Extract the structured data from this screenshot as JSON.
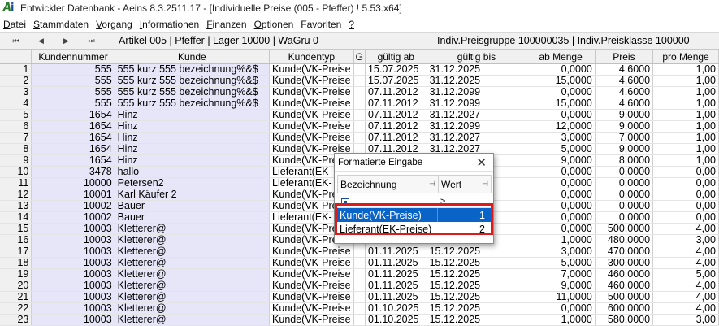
{
  "window": {
    "title": "Entwickler Datenbank - Aeins 8.3.2511.17 - [Individuelle Preise (005 - Pfeffer) ! 5.53.x64]",
    "logo_text_a": "A",
    "logo_text_i": "i"
  },
  "menu": [
    {
      "accel": "D",
      "rest": "atei"
    },
    {
      "accel": "S",
      "rest": "tammdaten"
    },
    {
      "accel": "V",
      "rest": "organg"
    },
    {
      "accel": "I",
      "rest": "nformationen"
    },
    {
      "accel": "F",
      "rest": "inanzen"
    },
    {
      "accel": "O",
      "rest": "ptionen"
    },
    {
      "accel": "",
      "rest": "Favoriten"
    },
    {
      "accel": "?",
      "rest": ""
    }
  ],
  "nav": {
    "first_icon": "first-record-icon",
    "prev_icon": "prev-record-icon",
    "next_icon": "next-record-icon",
    "last_icon": "last-record-icon",
    "info": "Artikel 005 | Pfeffer | Lager 10000 | WaGru 0",
    "right_info": "Indiv.Preisgruppe 100000035 |  Indiv.Preisklasse 100000"
  },
  "grid": {
    "columns": [
      "",
      "Kundennummer",
      "Kunde",
      "Kundentyp",
      "G",
      "gültig ab",
      "gültig bis",
      "ab Menge",
      "Preis",
      "pro Menge"
    ],
    "rows": [
      [
        "1",
        "555",
        "555 kurz 555 bezeichnung%&$",
        "Kunde(VK-Preise",
        "",
        "15.07.2025",
        "31.12.2025",
        "0,0000",
        "4,6000",
        "1,00"
      ],
      [
        "2",
        "555",
        "555 kurz 555 bezeichnung%&$",
        "Kunde(VK-Preise",
        "",
        "15.07.2025",
        "31.12.2025",
        "15,0000",
        "4,6000",
        "1,00"
      ],
      [
        "3",
        "555",
        "555 kurz 555 bezeichnung%&$",
        "Kunde(VK-Preise",
        "",
        "07.11.2012",
        "31.12.2099",
        "0,0000",
        "4,6000",
        "1,00"
      ],
      [
        "4",
        "555",
        "555 kurz 555 bezeichnung%&$",
        "Kunde(VK-Preise",
        "",
        "07.11.2012",
        "31.12.2099",
        "15,0000",
        "4,6000",
        "1,00"
      ],
      [
        "5",
        "1654",
        "Hinz",
        "Kunde(VK-Preise",
        "",
        "07.11.2012",
        "31.12.2027",
        "0,0000",
        "9,0000",
        "1,00"
      ],
      [
        "6",
        "1654",
        "Hinz",
        "Kunde(VK-Preise",
        "",
        "07.11.2012",
        "31.12.2099",
        "12,0000",
        "9,0000",
        "1,00"
      ],
      [
        "7",
        "1654",
        "Hinz",
        "Kunde(VK-Preise",
        "",
        "07.11.2012",
        "31.12.2027",
        "3,0000",
        "7,0000",
        "1,00"
      ],
      [
        "8",
        "1654",
        "Hinz",
        "Kunde(VK-Preise",
        "",
        "07.11.2012",
        "31.12.2027",
        "5,0000",
        "9,0000",
        "1,00"
      ],
      [
        "9",
        "1654",
        "Hinz",
        "Kunde(VK-Prei",
        "",
        "",
        "",
        "9,0000",
        "8,0000",
        "1,00"
      ],
      [
        "10",
        "3478",
        "hallo",
        "Lieferant(EK-",
        "",
        "",
        "",
        "0,0000",
        "0,0000",
        "0,00"
      ],
      [
        "11",
        "10000",
        "Petersen2",
        "Lieferant(EK-",
        "",
        "",
        "",
        "0,0000",
        "0,0000",
        "0,00"
      ],
      [
        "12",
        "10001",
        "Karl Käufer 2",
        "Kunde(VK-Prei",
        "",
        "",
        "",
        "0,0000",
        "0,0000",
        "0,00"
      ],
      [
        "13",
        "10002",
        "Bauer",
        "Kunde(VK-Prei",
        "",
        "",
        "",
        "0,0000",
        "0,0000",
        "0,00"
      ],
      [
        "14",
        "10002",
        "Bauer",
        "Lieferant(EK-",
        "",
        "",
        "",
        "0,0000",
        "0,0000",
        "0,00"
      ],
      [
        "15",
        "10003",
        "Kletterer@",
        "Kunde(VK-Prei",
        "",
        "",
        "",
        "0,0000",
        "500,0000",
        "4,00"
      ],
      [
        "16",
        "10003",
        "Kletterer@",
        "Kunde(VK-Prei",
        "",
        "",
        "",
        "1,0000",
        "480,0000",
        "3,00"
      ],
      [
        "17",
        "10003",
        "Kletterer@",
        "Kunde(VK-Preise",
        "",
        "01.11.2025",
        "15.12.2025",
        "3,0000",
        "470,0000",
        "4,00"
      ],
      [
        "18",
        "10003",
        "Kletterer@",
        "Kunde(VK-Preise",
        "",
        "01.11.2025",
        "15.12.2025",
        "5,0000",
        "300,0000",
        "4,00"
      ],
      [
        "19",
        "10003",
        "Kletterer@",
        "Kunde(VK-Preise",
        "",
        "01.11.2025",
        "15.12.2025",
        "7,0000",
        "460,0000",
        "5,00"
      ],
      [
        "20",
        "10003",
        "Kletterer@",
        "Kunde(VK-Preise",
        "",
        "01.11.2025",
        "15.12.2025",
        "9,0000",
        "460,0000",
        "4,00"
      ],
      [
        "21",
        "10003",
        "Kletterer@",
        "Kunde(VK-Preise",
        "",
        "01.11.2025",
        "15.12.2025",
        "11,0000",
        "500,0000",
        "4,00"
      ],
      [
        "22",
        "10003",
        "Kletterer@",
        "Kunde(VK-Preise",
        "",
        "01.10.2025",
        "15.12.2025",
        "0,0000",
        "600,0000",
        "4,00"
      ],
      [
        "23",
        "10003",
        "Kletterer@",
        "Kunde(VK-Preise",
        "",
        "01.10.2025",
        "15.12.2025",
        "1,0000",
        "580,0000",
        "3,00"
      ],
      [
        "24",
        "10003",
        "Kletterer@",
        "Kunde(VK-Preise",
        "",
        "01.10.2025",
        "15.12.2025",
        "3,0000",
        "570,0000",
        "3,00"
      ]
    ]
  },
  "popup": {
    "title": "Formatierte Eingabe",
    "close_label": "✕",
    "col_bezeichnung": "Bezeichnung",
    "col_wert": "Wert",
    "pin_icon": "pin-icon",
    "filter_op": "≥",
    "options": [
      {
        "label": "Kunde(VK-Preise)",
        "value": "1",
        "selected": true
      },
      {
        "label": "Lieferant(EK-Preise)",
        "value": "2",
        "selected": false
      }
    ]
  },
  "colors": {
    "selection": "#0a64c8",
    "highlight": "#e01a1a",
    "customer_column_bg": "#e6e6f8"
  }
}
